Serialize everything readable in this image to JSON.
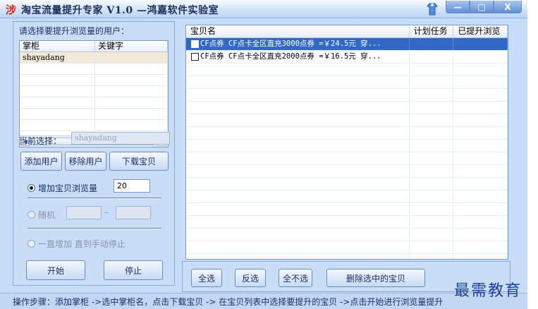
{
  "window": {
    "logo": "涉",
    "title": "淘宝流量提升专家 V1.0 —鸿嘉软件实验室",
    "minimize": "—",
    "restore": "□",
    "close": "X"
  },
  "left": {
    "group_label": "请选择要提升浏览量的用户：",
    "user_columns": [
      "掌柜",
      "关键字"
    ],
    "users": [
      {
        "name": "shayadang",
        "keyword": ""
      }
    ],
    "current_label": "当前选择：",
    "current_value": "shayadang",
    "add_user": "添加用户",
    "remove_user": "移除用户",
    "download": "下载宝贝",
    "radio_increase": "增加宝贝浏览量",
    "increase_value": "20",
    "radio_random": "随机",
    "random_dash": "–",
    "radio_always": "一直增加 直到手动停止",
    "start": "开始",
    "stop": "停止"
  },
  "products": {
    "columns": [
      "宝贝名",
      "计划任务",
      "已提升浏览"
    ],
    "rows": [
      {
        "name": "CF点券 CF点卡全区直充3000点券 =￥24.5元 穿...",
        "plan": "",
        "done": ""
      },
      {
        "name": "CF点券 CF点卡全区直充2000点券 =￥16.5元 穿...",
        "plan": "",
        "done": ""
      }
    ]
  },
  "bottom": {
    "select_all": "全选",
    "invert": "反选",
    "select_none": "全不选",
    "delete_selected": "删除选中的宝贝"
  },
  "status": "操作步骤：添加掌柜 ->选中掌柜名，点击下载宝贝 -> 在宝贝列表中选择要提升的宝贝 ->点击开始进行浏览量提升",
  "watermark": "最需教育"
}
